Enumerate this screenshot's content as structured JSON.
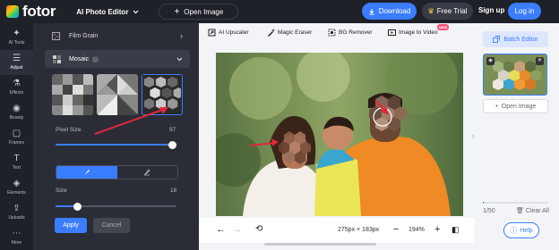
{
  "topbar": {
    "logo_text": "fotor",
    "editor_menu": "AI Photo Editor",
    "open_image": "Open Image",
    "download": "Download",
    "free_trial": "Free Trial",
    "sign_up": "Sign up",
    "log_in": "Log in"
  },
  "leftnav": {
    "items": [
      {
        "label": "AI Tools",
        "icon": "ai-tools-icon"
      },
      {
        "label": "Adjust",
        "icon": "adjust-icon"
      },
      {
        "label": "Effects",
        "icon": "effects-icon"
      },
      {
        "label": "Beauty",
        "icon": "beauty-icon"
      },
      {
        "label": "Frames",
        "icon": "frames-icon"
      },
      {
        "label": "Text",
        "icon": "text-icon"
      },
      {
        "label": "Elements",
        "icon": "elements-icon"
      },
      {
        "label": "Uploads",
        "icon": "uploads-icon"
      },
      {
        "label": "More",
        "icon": "more-icon"
      }
    ]
  },
  "panel": {
    "film_grain": "Film Grain",
    "mosaic": "Mosaic",
    "pixel_size_label": "Pixel Size",
    "pixel_size_value": "97",
    "pixel_size_fraction": 0.97,
    "size_label": "Size",
    "size_value": "18",
    "size_fraction": 0.18,
    "apply": "Apply",
    "cancel": "Cancel"
  },
  "tools": {
    "ai_upscaler": "AI Upscaler",
    "magic_eraser": "Magic Eraser",
    "bg_remover": "BG Remover",
    "image_to_video": "Image to Video",
    "new_badge": "NEW"
  },
  "bottombar": {
    "dimensions": "275px × 183px",
    "zoom": "194%"
  },
  "rightpanel": {
    "batch_editor": "Batch Editor",
    "open_image": "Open Image",
    "count": "1/50",
    "clear_all": "Clear All",
    "help": "Help"
  },
  "colors": {
    "accent": "#3a7dff",
    "dark_bg": "#1f2129",
    "panel_bg": "#2b2d36",
    "arrow_red": "#e0283a",
    "badge_pink": "#ff4d7a"
  }
}
